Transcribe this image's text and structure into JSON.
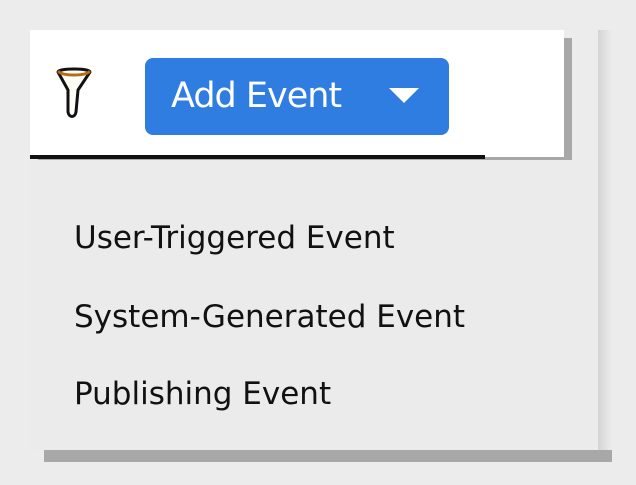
{
  "toolbar": {
    "add_event_label": "Add Event"
  },
  "menu": {
    "items": [
      {
        "label": "User-Triggered Event"
      },
      {
        "label": "System-Generated Event"
      },
      {
        "label": "Publishing Event"
      }
    ]
  },
  "colors": {
    "accent": "#2f7de1",
    "menu_background": "#ebebeb",
    "text": "#111111"
  },
  "icons": {
    "filter": "filter-icon",
    "dropdown": "chevron-down-icon"
  }
}
